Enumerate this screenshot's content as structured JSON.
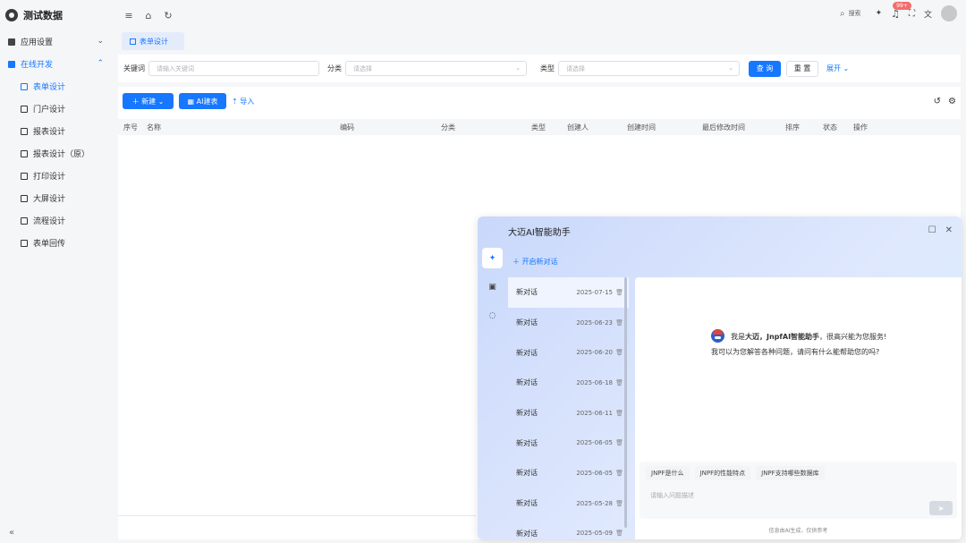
{
  "app": {
    "title": "测试数据"
  },
  "sidebar": {
    "groups": [
      {
        "label": "应用设置",
        "icon": "grid-icon",
        "expanded": false
      },
      {
        "label": "在线开发",
        "icon": "code-icon",
        "expanded": true
      }
    ],
    "items": [
      {
        "label": "表单设计",
        "icon": "form-icon",
        "active": true
      },
      {
        "label": "门户设计",
        "icon": "portal-icon"
      },
      {
        "label": "报表设计",
        "icon": "report-icon"
      },
      {
        "label": "报表设计（原）",
        "icon": "report-icon"
      },
      {
        "label": "打印设计",
        "icon": "print-icon"
      },
      {
        "label": "大屏设计",
        "icon": "screen-icon"
      },
      {
        "label": "流程设计",
        "icon": "flow-icon"
      },
      {
        "label": "表单回传",
        "icon": "return-icon"
      }
    ],
    "collapse": "«"
  },
  "topbar": {
    "search_label": "搜索",
    "notification_count": "99+"
  },
  "tabs": [
    {
      "label": "表单设计"
    }
  ],
  "filter": {
    "keyword_label": "关键词",
    "keyword_placeholder": "请输入关键词",
    "category_label": "分类",
    "category_placeholder": "请选择",
    "type_label": "类型",
    "type_placeholder": "请选择",
    "query_label": "查 询",
    "reset_label": "重 置",
    "expand_label": "展开"
  },
  "toolbar": {
    "new_label": "新建",
    "ai_label": "AI建表",
    "import_label": "导入"
  },
  "table": {
    "columns": [
      "序号",
      "名称",
      "编码",
      "分类",
      "类型",
      "创建人",
      "创建时间",
      "最后修改时间",
      "排序",
      "状态",
      "操作"
    ]
  },
  "ai_panel": {
    "title": "大迈AI智能助手",
    "new_chat_label": "开启新对话",
    "conversations": [
      {
        "title": "新对话",
        "date": "2025-07-15"
      },
      {
        "title": "新对话",
        "date": "2025-06-23"
      },
      {
        "title": "新对话",
        "date": "2025-06-20"
      },
      {
        "title": "新对话",
        "date": "2025-06-18"
      },
      {
        "title": "新对话",
        "date": "2025-06-11"
      },
      {
        "title": "新对话",
        "date": "2025-06-05"
      },
      {
        "title": "新对话",
        "date": "2025-06-05"
      },
      {
        "title": "新对话",
        "date": "2025-05-28"
      },
      {
        "title": "新对话",
        "date": "2025-05-09"
      }
    ],
    "welcome_prefix": "我是",
    "welcome_name": "大迈，JnpfAI智能助手",
    "welcome_suffix": "，很高兴能为您服务!",
    "welcome_line2": "我可以为您解答各种问题，请问有什么能帮助您的吗?",
    "suggestions": [
      "JNPF是什么",
      "JNPF的性能特点",
      "JNPF支持哪些数据库"
    ],
    "input_placeholder": "请输入问题描述",
    "disclaimer": "信息由AI生成，仅供参考"
  },
  "colors": {
    "accent": "#1677ff",
    "badge": "#f56c6c"
  }
}
